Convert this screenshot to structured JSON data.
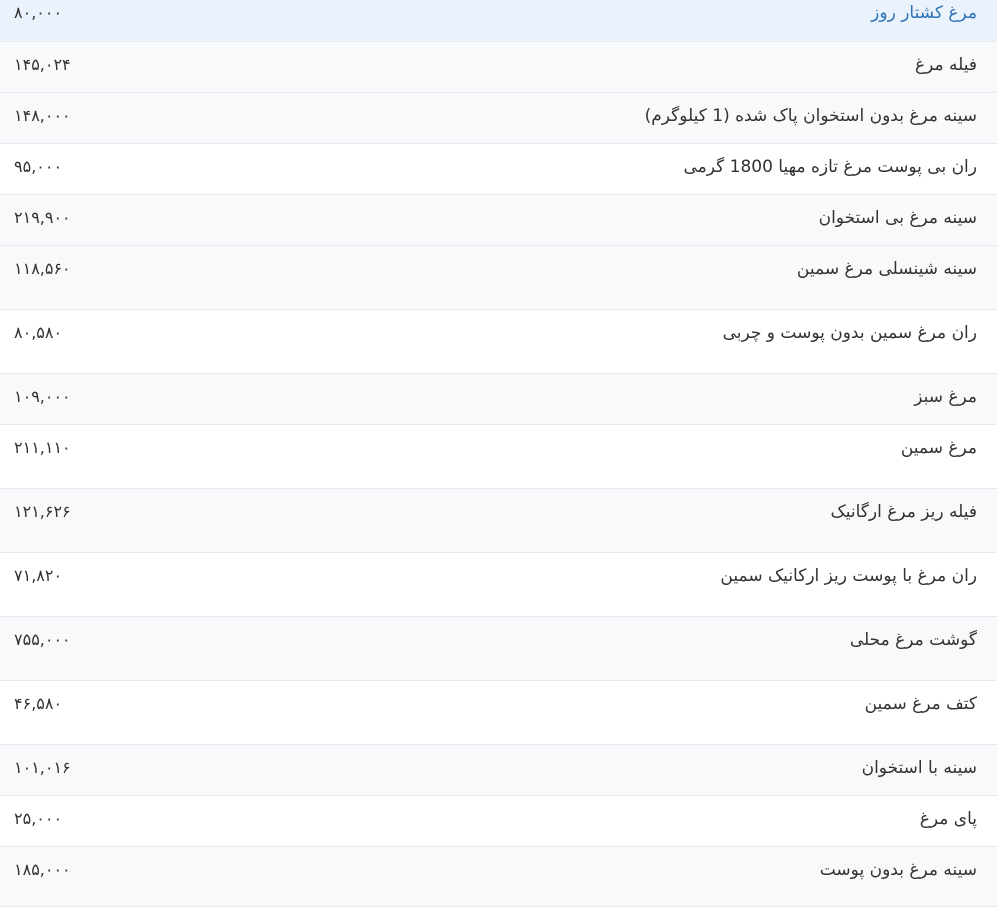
{
  "rows": [
    {
      "name": "مرغ کشتار روز",
      "price": "۸۰,۰۰۰"
    },
    {
      "name": "فیله مرغ",
      "price": "۱۴۵,۰۲۴"
    },
    {
      "name": "سینه مرغ بدون استخوان پاک شده (1 کیلوگرم)",
      "price": "۱۴۸,۰۰۰"
    },
    {
      "name": "ران بی پوست مرغ تازه مهیا 1800 گرمی",
      "price": "۹۵,۰۰۰"
    },
    {
      "name": "سینه مرغ بی استخوان",
      "price": "۲۱۹,۹۰۰"
    },
    {
      "name": "سینه شینسلی مرغ سمین",
      "price": "۱۱۸,۵۶۰"
    },
    {
      "name": "ران مرغ سمین بدون پوست و چربی",
      "price": "۸۰,۵۸۰"
    },
    {
      "name": "مرغ سبز",
      "price": "۱۰۹,۰۰۰"
    },
    {
      "name": "مرغ سمین",
      "price": "۲۱۱,۱۱۰"
    },
    {
      "name": "فیله ریز مرغ ارگانیک",
      "price": "۱۲۱,۶۲۶"
    },
    {
      "name": "ران مرغ با پوست ریز ارکانیک سمین",
      "price": "۷۱,۸۲۰"
    },
    {
      "name": "گوشت مرغ محلی",
      "price": "۷۵۵,۰۰۰"
    },
    {
      "name": "کتف مرغ سمین",
      "price": "۴۶,۵۸۰"
    },
    {
      "name": "سینه با استخوان",
      "price": "۱۰۱,۰۱۶"
    },
    {
      "name": "پای مرغ",
      "price": "۲۵,۰۰۰"
    },
    {
      "name": "سینه مرغ بدون پوست",
      "price": "۱۸۵,۰۰۰"
    }
  ],
  "colors": {
    "highlight_bg": "#eaf2fb",
    "highlight_text": "#2e73b8",
    "row_alt_bg": "#f8f9fb",
    "border": "#e6e9ee"
  }
}
